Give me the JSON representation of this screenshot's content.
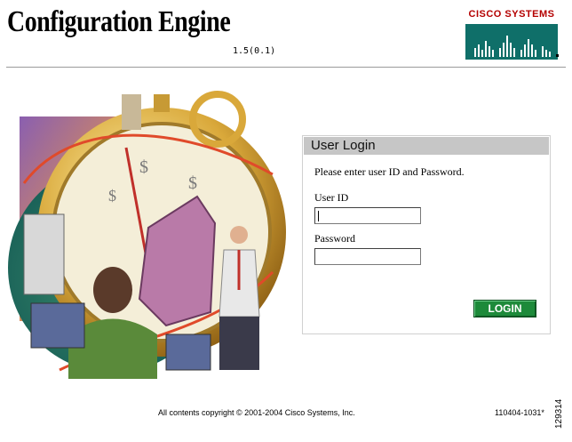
{
  "header": {
    "title": "Configuration Engine",
    "version": "1.5(0.1)",
    "logo": {
      "text": "Cisco Systems",
      "brand_color": "#b40000",
      "box_color": "#0f6f69"
    }
  },
  "login": {
    "panel_title": "User Login",
    "instructions": "Please enter user ID and Password.",
    "user_id_label": "User ID",
    "user_id_value": "",
    "password_label": "Password",
    "password_value": "",
    "login_button": "LOGIN",
    "header_color": "#c6c6c6",
    "button_color": "#1d8a3a"
  },
  "footer": {
    "copyright": "All contents copyright © 2001-2004 Cisco Systems, Inc.",
    "build": "110404-1031*",
    "figure_number": "129314"
  },
  "illustration": {
    "icon": "stopwatch-globe-illustration"
  }
}
